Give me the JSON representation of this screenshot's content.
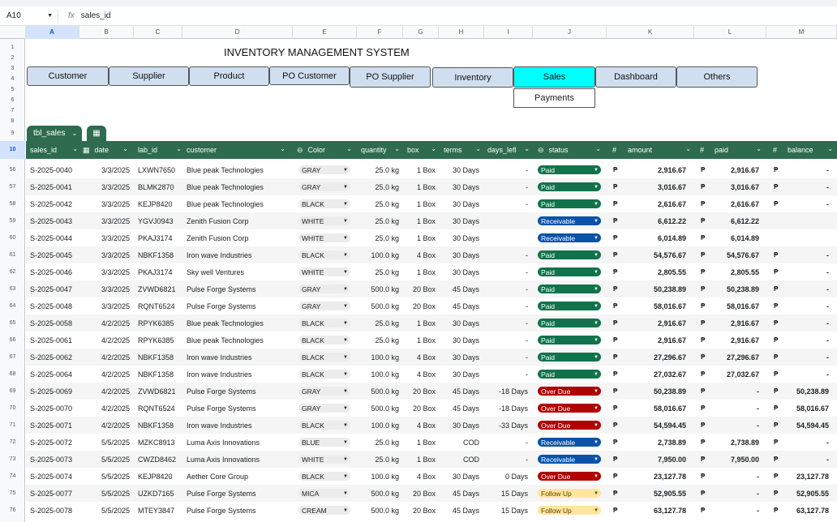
{
  "formula_bar": {
    "cell_ref": "A10",
    "fx": "fx",
    "value": "sales_id"
  },
  "columns": [
    "A",
    "B",
    "C",
    "D",
    "E",
    "F",
    "G",
    "H",
    "I",
    "J",
    "K",
    "L",
    "M"
  ],
  "title": "INVENTORY MANAGEMENT SYSTEM",
  "nav": [
    "Customer",
    "Supplier",
    "Product",
    "PO Customer",
    "PO Supplier",
    "Inventory",
    "Sales",
    "Dashboard",
    "Others"
  ],
  "sub_nav": "Payments",
  "table_name": "tbl_sales",
  "headers": {
    "sales_id": "sales_id",
    "date": "date",
    "lab_id": "lab_id",
    "customer": "customer",
    "color": "Color",
    "quantity": "quantity",
    "box": "box",
    "terms": "terms",
    "days_left": "days_lefl",
    "status": "status",
    "amount_hash": "#",
    "amount": "amount",
    "paid_hash": "#",
    "paid": "paid",
    "balance_hash": "#",
    "balance": "balance"
  },
  "upper_row_numbers": [
    "1",
    "2",
    "3",
    "4",
    "5",
    "6",
    "7",
    "8",
    "9",
    "10"
  ],
  "rows": [
    {
      "n": "56",
      "id": "S-2025-0040",
      "date": "3/3/2025",
      "lab": "LXWN7650",
      "cust": "Blue peak Technologies",
      "color": "GRAY",
      "qty": "25.0 kg",
      "box": "1 Box",
      "terms": "30 Days",
      "days": "-",
      "status": "Paid",
      "ap": "₱",
      "amount": "2,916.67",
      "pp": "₱",
      "paid": "2,916.67",
      "bp": "₱",
      "balance": "-"
    },
    {
      "n": "57",
      "id": "S-2025-0041",
      "date": "3/3/2025",
      "lab": "BLMK2870",
      "cust": "Blue peak Technologies",
      "color": "GRAY",
      "qty": "25.0 kg",
      "box": "1 Box",
      "terms": "30 Days",
      "days": "-",
      "status": "Paid",
      "ap": "₱",
      "amount": "3,016.67",
      "pp": "₱",
      "paid": "3,016.67",
      "bp": "₱",
      "balance": "-"
    },
    {
      "n": "58",
      "id": "S-2025-0042",
      "date": "3/3/2025",
      "lab": "KEJP8420",
      "cust": "Blue peak Technologies",
      "color": "BLACK",
      "qty": "25.0 kg",
      "box": "1 Box",
      "terms": "30 Days",
      "days": "-",
      "status": "Paid",
      "ap": "₱",
      "amount": "2,616.67",
      "pp": "₱",
      "paid": "2,616.67",
      "bp": "₱",
      "balance": "-"
    },
    {
      "n": "59",
      "id": "S-2025-0043",
      "date": "3/3/2025",
      "lab": "YGVJ0943",
      "cust": "Zenith Fusion Corp",
      "color": "WHITE",
      "qty": "25.0 kg",
      "box": "1 Box",
      "terms": "30 Days",
      "days": "",
      "status": "Receivable",
      "ap": "₱",
      "amount": "6,612.22",
      "pp": "₱",
      "paid": "6,612.22",
      "bp": "",
      "balance": ""
    },
    {
      "n": "60",
      "id": "S-2025-0044",
      "date": "3/3/2025",
      "lab": "PKAJ3174",
      "cust": "Zenith Fusion Corp",
      "color": "WHITE",
      "qty": "25.0 kg",
      "box": "1 Box",
      "terms": "30 Days",
      "days": "",
      "status": "Receivable",
      "ap": "₱",
      "amount": "6,014.89",
      "pp": "₱",
      "paid": "6,014.89",
      "bp": "",
      "balance": ""
    },
    {
      "n": "61",
      "id": "S-2025-0045",
      "date": "3/3/2025",
      "lab": "NBKF1358",
      "cust": "Iron wave Industries",
      "color": "BLACK",
      "qty": "100.0 kg",
      "box": "4 Box",
      "terms": "30 Days",
      "days": "-",
      "status": "Paid",
      "ap": "₱",
      "amount": "54,576.67",
      "pp": "₱",
      "paid": "54,576.67",
      "bp": "₱",
      "balance": "-"
    },
    {
      "n": "62",
      "id": "S-2025-0046",
      "date": "3/3/2025",
      "lab": "PKAJ3174",
      "cust": "Sky well Ventures",
      "color": "WHITE",
      "qty": "25.0 kg",
      "box": "1 Box",
      "terms": "30 Days",
      "days": "-",
      "status": "Paid",
      "ap": "₱",
      "amount": "2,805.55",
      "pp": "₱",
      "paid": "2,805.55",
      "bp": "₱",
      "balance": "-"
    },
    {
      "n": "63",
      "id": "S-2025-0047",
      "date": "3/3/2025",
      "lab": "ZVWD6821",
      "cust": "Pulse Forge Systems",
      "color": "GRAY",
      "qty": "500.0 kg",
      "box": "20 Box",
      "terms": "45 Days",
      "days": "-",
      "status": "Paid",
      "ap": "₱",
      "amount": "50,238.89",
      "pp": "₱",
      "paid": "50,238.89",
      "bp": "₱",
      "balance": "-"
    },
    {
      "n": "64",
      "id": "S-2025-0048",
      "date": "3/3/2025",
      "lab": "RQNT6524",
      "cust": "Pulse Forge Systems",
      "color": "GRAY",
      "qty": "500.0 kg",
      "box": "20 Box",
      "terms": "45 Days",
      "days": "-",
      "status": "Paid",
      "ap": "₱",
      "amount": "58,016.67",
      "pp": "₱",
      "paid": "58,016.67",
      "bp": "₱",
      "balance": "-"
    },
    {
      "n": "65",
      "id": "S-2025-0058",
      "date": "4/2/2025",
      "lab": "RPYK6385",
      "cust": "Blue peak Technologies",
      "color": "BLACK",
      "qty": "25.0 kg",
      "box": "1 Box",
      "terms": "30 Days",
      "days": "-",
      "status": "Paid",
      "ap": "₱",
      "amount": "2,916.67",
      "pp": "₱",
      "paid": "2,916.67",
      "bp": "₱",
      "balance": "-"
    },
    {
      "n": "66",
      "id": "S-2025-0061",
      "date": "4/2/2025",
      "lab": "RPYK6385",
      "cust": "Blue peak Technologies",
      "color": "BLACK",
      "qty": "25.0 kg",
      "box": "1 Box",
      "terms": "30 Days",
      "days": "-",
      "status": "Paid",
      "ap": "₱",
      "amount": "2,916.67",
      "pp": "₱",
      "paid": "2,916.67",
      "bp": "₱",
      "balance": "-"
    },
    {
      "n": "67",
      "id": "S-2025-0062",
      "date": "4/2/2025",
      "lab": "NBKF1358",
      "cust": "Iron wave Industries",
      "color": "BLACK",
      "qty": "100.0 kg",
      "box": "4 Box",
      "terms": "30 Days",
      "days": "-",
      "status": "Paid",
      "ap": "₱",
      "amount": "27,296.67",
      "pp": "₱",
      "paid": "27,296.67",
      "bp": "₱",
      "balance": "-"
    },
    {
      "n": "68",
      "id": "S-2025-0064",
      "date": "4/2/2025",
      "lab": "NBKF1358",
      "cust": "Iron wave Industries",
      "color": "BLACK",
      "qty": "100.0 kg",
      "box": "4 Box",
      "terms": "30 Days",
      "days": "-",
      "status": "Paid",
      "ap": "₱",
      "amount": "27,032.67",
      "pp": "₱",
      "paid": "27,032.67",
      "bp": "₱",
      "balance": "-"
    },
    {
      "n": "69",
      "id": "S-2025-0069",
      "date": "4/2/2025",
      "lab": "ZVWD6821",
      "cust": "Pulse Forge Systems",
      "color": "GRAY",
      "qty": "500.0 kg",
      "box": "20 Box",
      "terms": "45 Days",
      "days": "-18 Days",
      "status": "Over Due",
      "ap": "₱",
      "amount": "50,238.89",
      "pp": "₱",
      "paid": "-",
      "bp": "₱",
      "balance": "50,238.89"
    },
    {
      "n": "70",
      "id": "S-2025-0070",
      "date": "4/2/2025",
      "lab": "RQNT6524",
      "cust": "Pulse Forge Systems",
      "color": "GRAY",
      "qty": "500.0 kg",
      "box": "20 Box",
      "terms": "45 Days",
      "days": "-18 Days",
      "status": "Over Due",
      "ap": "₱",
      "amount": "58,016.67",
      "pp": "₱",
      "paid": "-",
      "bp": "₱",
      "balance": "58,016.67"
    },
    {
      "n": "71",
      "id": "S-2025-0071",
      "date": "4/2/2025",
      "lab": "NBKF1358",
      "cust": "Iron wave Industries",
      "color": "BLACK",
      "qty": "100.0 kg",
      "box": "4 Box",
      "terms": "30 Days",
      "days": "-33 Days",
      "status": "Over Due",
      "ap": "₱",
      "amount": "54,594.45",
      "pp": "₱",
      "paid": "-",
      "bp": "₱",
      "balance": "54,594.45"
    },
    {
      "n": "72",
      "id": "S-2025-0072",
      "date": "5/5/2025",
      "lab": "MZKC8913",
      "cust": "Luma Axis Innovations",
      "color": "BLUE",
      "qty": "25.0 kg",
      "box": "1 Box",
      "terms": "COD",
      "days": "-",
      "status": "Receivable",
      "ap": "₱",
      "amount": "2,738.89",
      "pp": "₱",
      "paid": "2,738.89",
      "bp": "₱",
      "balance": "-"
    },
    {
      "n": "73",
      "id": "S-2025-0073",
      "date": "5/5/2025",
      "lab": "CWZD8462",
      "cust": "Luma Axis Innovations",
      "color": "WHITE",
      "qty": "25.0 kg",
      "box": "1 Box",
      "terms": "COD",
      "days": "-",
      "status": "Receivable",
      "ap": "₱",
      "amount": "7,950.00",
      "pp": "₱",
      "paid": "7,950.00",
      "bp": "₱",
      "balance": "-"
    },
    {
      "n": "74",
      "id": "S-2025-0074",
      "date": "5/5/2025",
      "lab": "KEJP8420",
      "cust": "Aether Core Group",
      "color": "BLACK",
      "qty": "100.0 kg",
      "box": "4 Box",
      "terms": "30 Days",
      "days": "0 Days",
      "status": "Over Due",
      "ap": "₱",
      "amount": "23,127.78",
      "pp": "₱",
      "paid": "-",
      "bp": "₱",
      "balance": "23,127.78"
    },
    {
      "n": "75",
      "id": "S-2025-0077",
      "date": "5/5/2025",
      "lab": "UZKD7165",
      "cust": "Pulse Forge Systems",
      "color": "MICA",
      "qty": "500.0 kg",
      "box": "20 Box",
      "terms": "45 Days",
      "days": "15 Days",
      "status": "Follow Up",
      "ap": "₱",
      "amount": "52,905.55",
      "pp": "₱",
      "paid": "-",
      "bp": "₱",
      "balance": "52,905.55"
    },
    {
      "n": "76",
      "id": "S-2025-0078",
      "date": "5/5/2025",
      "lab": "MTEY3847",
      "cust": "Pulse Forge Systems",
      "color": "CREAM",
      "qty": "500.0 kg",
      "box": "20 Box",
      "terms": "45 Days",
      "days": "15 Days",
      "status": "Follow Up",
      "ap": "₱",
      "amount": "63,127.78",
      "pp": "₱",
      "paid": "-",
      "bp": "₱",
      "balance": "63,127.78"
    }
  ]
}
